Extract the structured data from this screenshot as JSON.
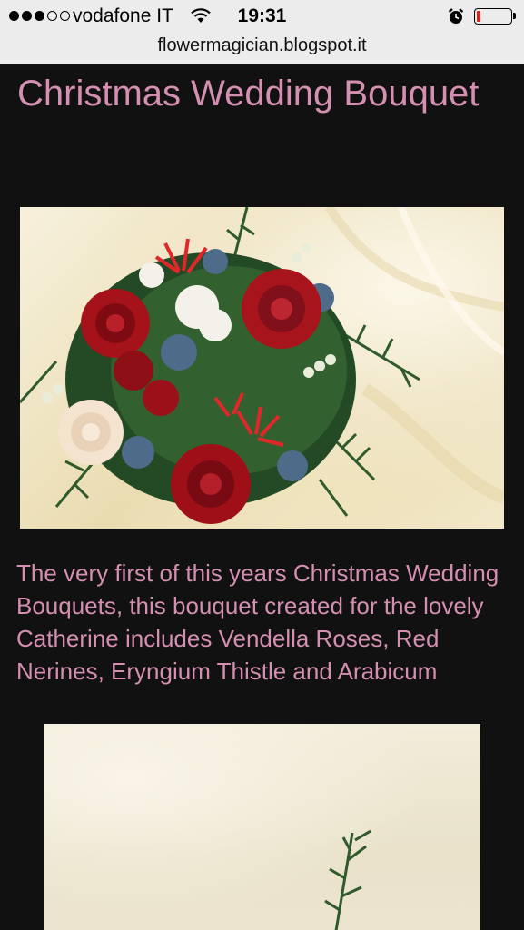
{
  "status_bar": {
    "carrier": "vodafone IT",
    "time": "19:31",
    "signal_bars_filled": 3,
    "signal_bars_total": 5,
    "battery_level_percent": 8,
    "icons": [
      "signal-dots-icon",
      "wifi-icon",
      "alarm-clock-icon",
      "battery-icon"
    ]
  },
  "browser": {
    "url": "flowermagician.blogspot.it"
  },
  "post": {
    "title": "Christmas Wedding Bouquet",
    "body": "The very first of this years Christmas Wedding Bouquets, this bouquet created for the lovely Catherine includes Vendella Roses, Red Nerines, Eryngium Thistle and Arabicum"
  },
  "colors": {
    "page_background": "#111111",
    "text_pink": "#d48fb1",
    "chrome_background": "#ececec",
    "battery_low": "#e02020"
  }
}
